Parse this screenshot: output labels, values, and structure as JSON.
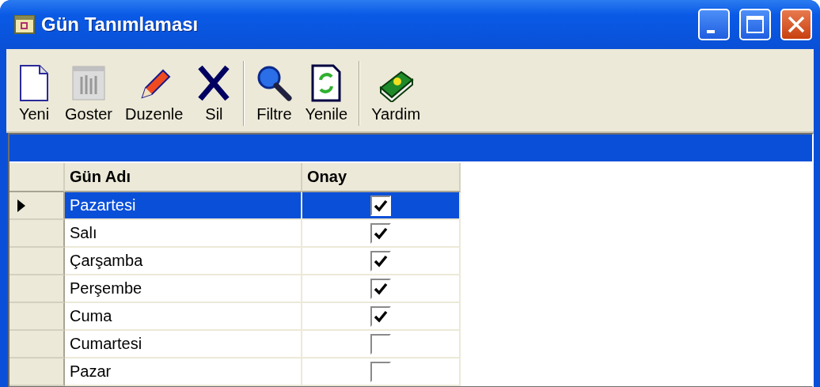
{
  "window": {
    "title": "Gün Tanımlaması"
  },
  "toolbar": {
    "groups": [
      [
        {
          "label": "Yeni"
        },
        {
          "label": "Goster"
        },
        {
          "label": "Duzenle"
        },
        {
          "label": "Sil"
        }
      ],
      [
        {
          "label": "Filtre"
        },
        {
          "label": "Yenile"
        }
      ],
      [
        {
          "label": "Yardim"
        }
      ]
    ]
  },
  "grid": {
    "columns": [
      "Gün Adı",
      "Onay"
    ],
    "rows": [
      {
        "name": "Pazartesi",
        "approved": true,
        "selected": true
      },
      {
        "name": "Salı",
        "approved": true,
        "selected": false
      },
      {
        "name": "Çarşamba",
        "approved": true,
        "selected": false
      },
      {
        "name": "Perşembe",
        "approved": true,
        "selected": false
      },
      {
        "name": "Cuma",
        "approved": true,
        "selected": false
      },
      {
        "name": "Cumartesi",
        "approved": false,
        "selected": false
      },
      {
        "name": "Pazar",
        "approved": false,
        "selected": false
      }
    ]
  }
}
